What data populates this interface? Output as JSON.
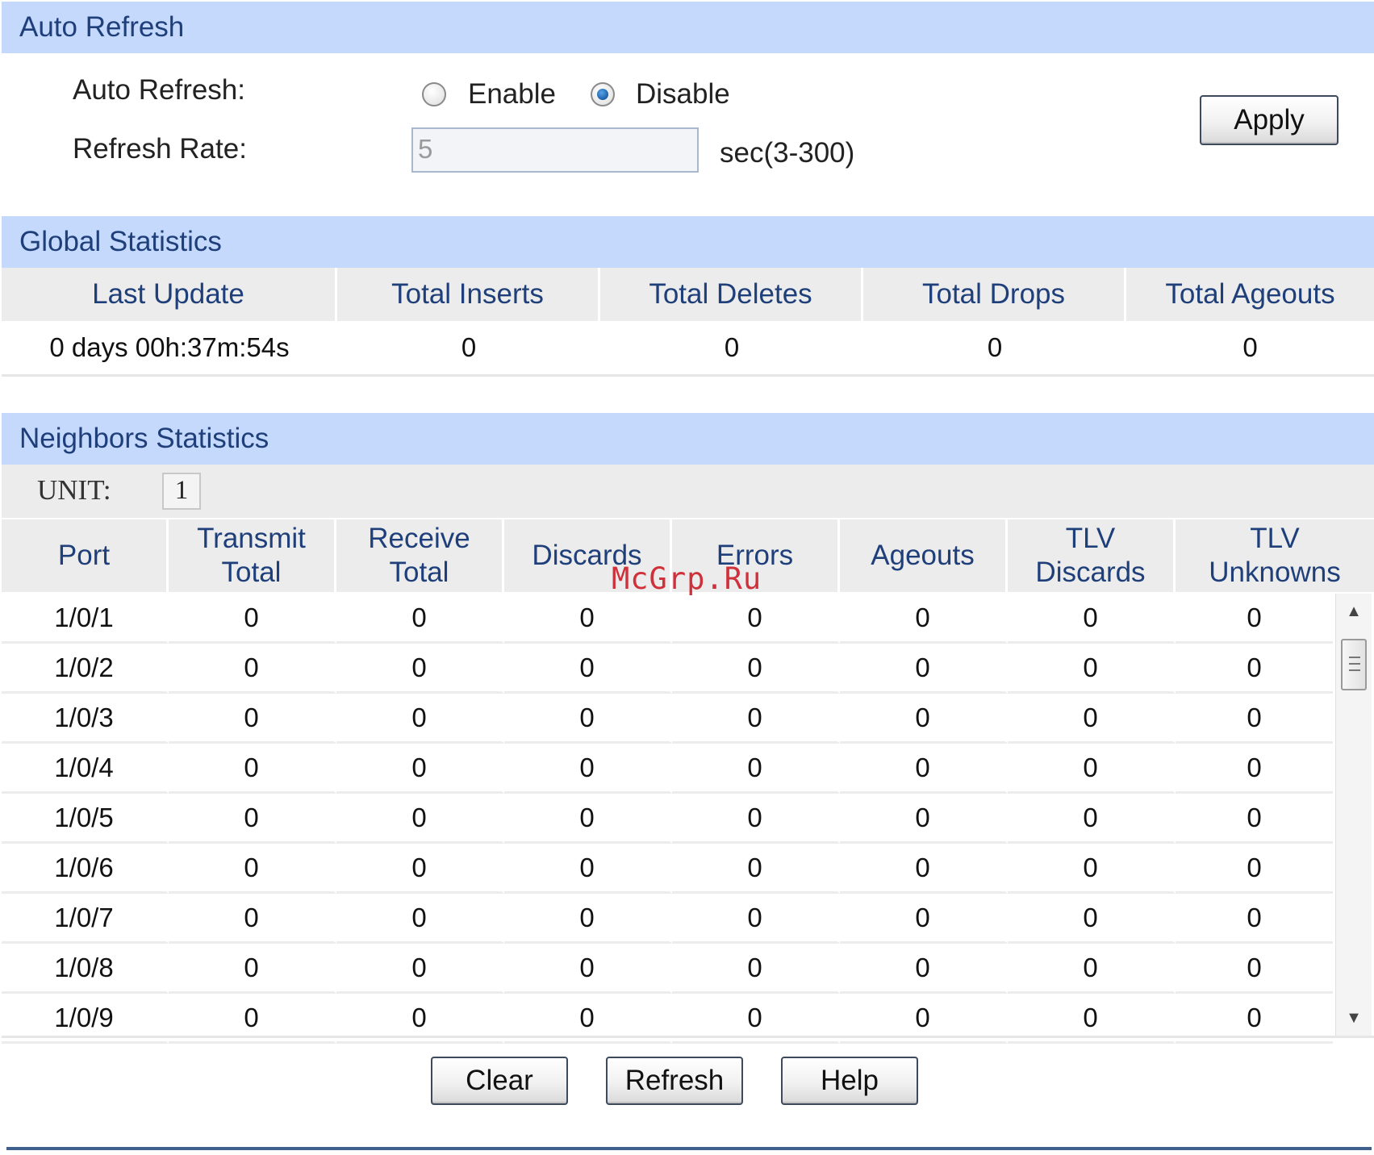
{
  "auto_refresh": {
    "header": "Auto Refresh",
    "auto_refresh_label": "Auto Refresh:",
    "enable_label": "Enable",
    "disable_label": "Disable",
    "selected": "Disable",
    "refresh_rate_label": "Refresh Rate:",
    "refresh_rate_value": "5",
    "refresh_rate_unit": "sec(3-300)",
    "apply_label": "Apply"
  },
  "global_statistics": {
    "header": "Global Statistics",
    "columns": [
      "Last Update",
      "Total Inserts",
      "Total Deletes",
      "Total Drops",
      "Total Ageouts"
    ],
    "values": [
      "0 days 00h:37m:54s",
      "0",
      "0",
      "0",
      "0"
    ]
  },
  "neighbors_statistics": {
    "header": "Neighbors Statistics",
    "unit_label": "UNIT:",
    "unit_value": "1",
    "columns": [
      "Port",
      "Transmit\nTotal",
      "Receive\nTotal",
      "Discards",
      "Errors",
      "Ageouts",
      "TLV\nDiscards",
      "TLV\nUnknowns"
    ],
    "rows": [
      [
        "1/0/1",
        "0",
        "0",
        "0",
        "0",
        "0",
        "0",
        "0"
      ],
      [
        "1/0/2",
        "0",
        "0",
        "0",
        "0",
        "0",
        "0",
        "0"
      ],
      [
        "1/0/3",
        "0",
        "0",
        "0",
        "0",
        "0",
        "0",
        "0"
      ],
      [
        "1/0/4",
        "0",
        "0",
        "0",
        "0",
        "0",
        "0",
        "0"
      ],
      [
        "1/0/5",
        "0",
        "0",
        "0",
        "0",
        "0",
        "0",
        "0"
      ],
      [
        "1/0/6",
        "0",
        "0",
        "0",
        "0",
        "0",
        "0",
        "0"
      ],
      [
        "1/0/7",
        "0",
        "0",
        "0",
        "0",
        "0",
        "0",
        "0"
      ],
      [
        "1/0/8",
        "0",
        "0",
        "0",
        "0",
        "0",
        "0",
        "0"
      ],
      [
        "1/0/9",
        "0",
        "0",
        "0",
        "0",
        "0",
        "0",
        "0"
      ]
    ]
  },
  "actions": {
    "clear_label": "Clear",
    "refresh_label": "Refresh",
    "help_label": "Help"
  },
  "watermark": "McGrp.Ru",
  "icons": {
    "scroll_up": "scroll-up-arrow-icon",
    "scroll_down": "scroll-down-arrow-icon"
  }
}
